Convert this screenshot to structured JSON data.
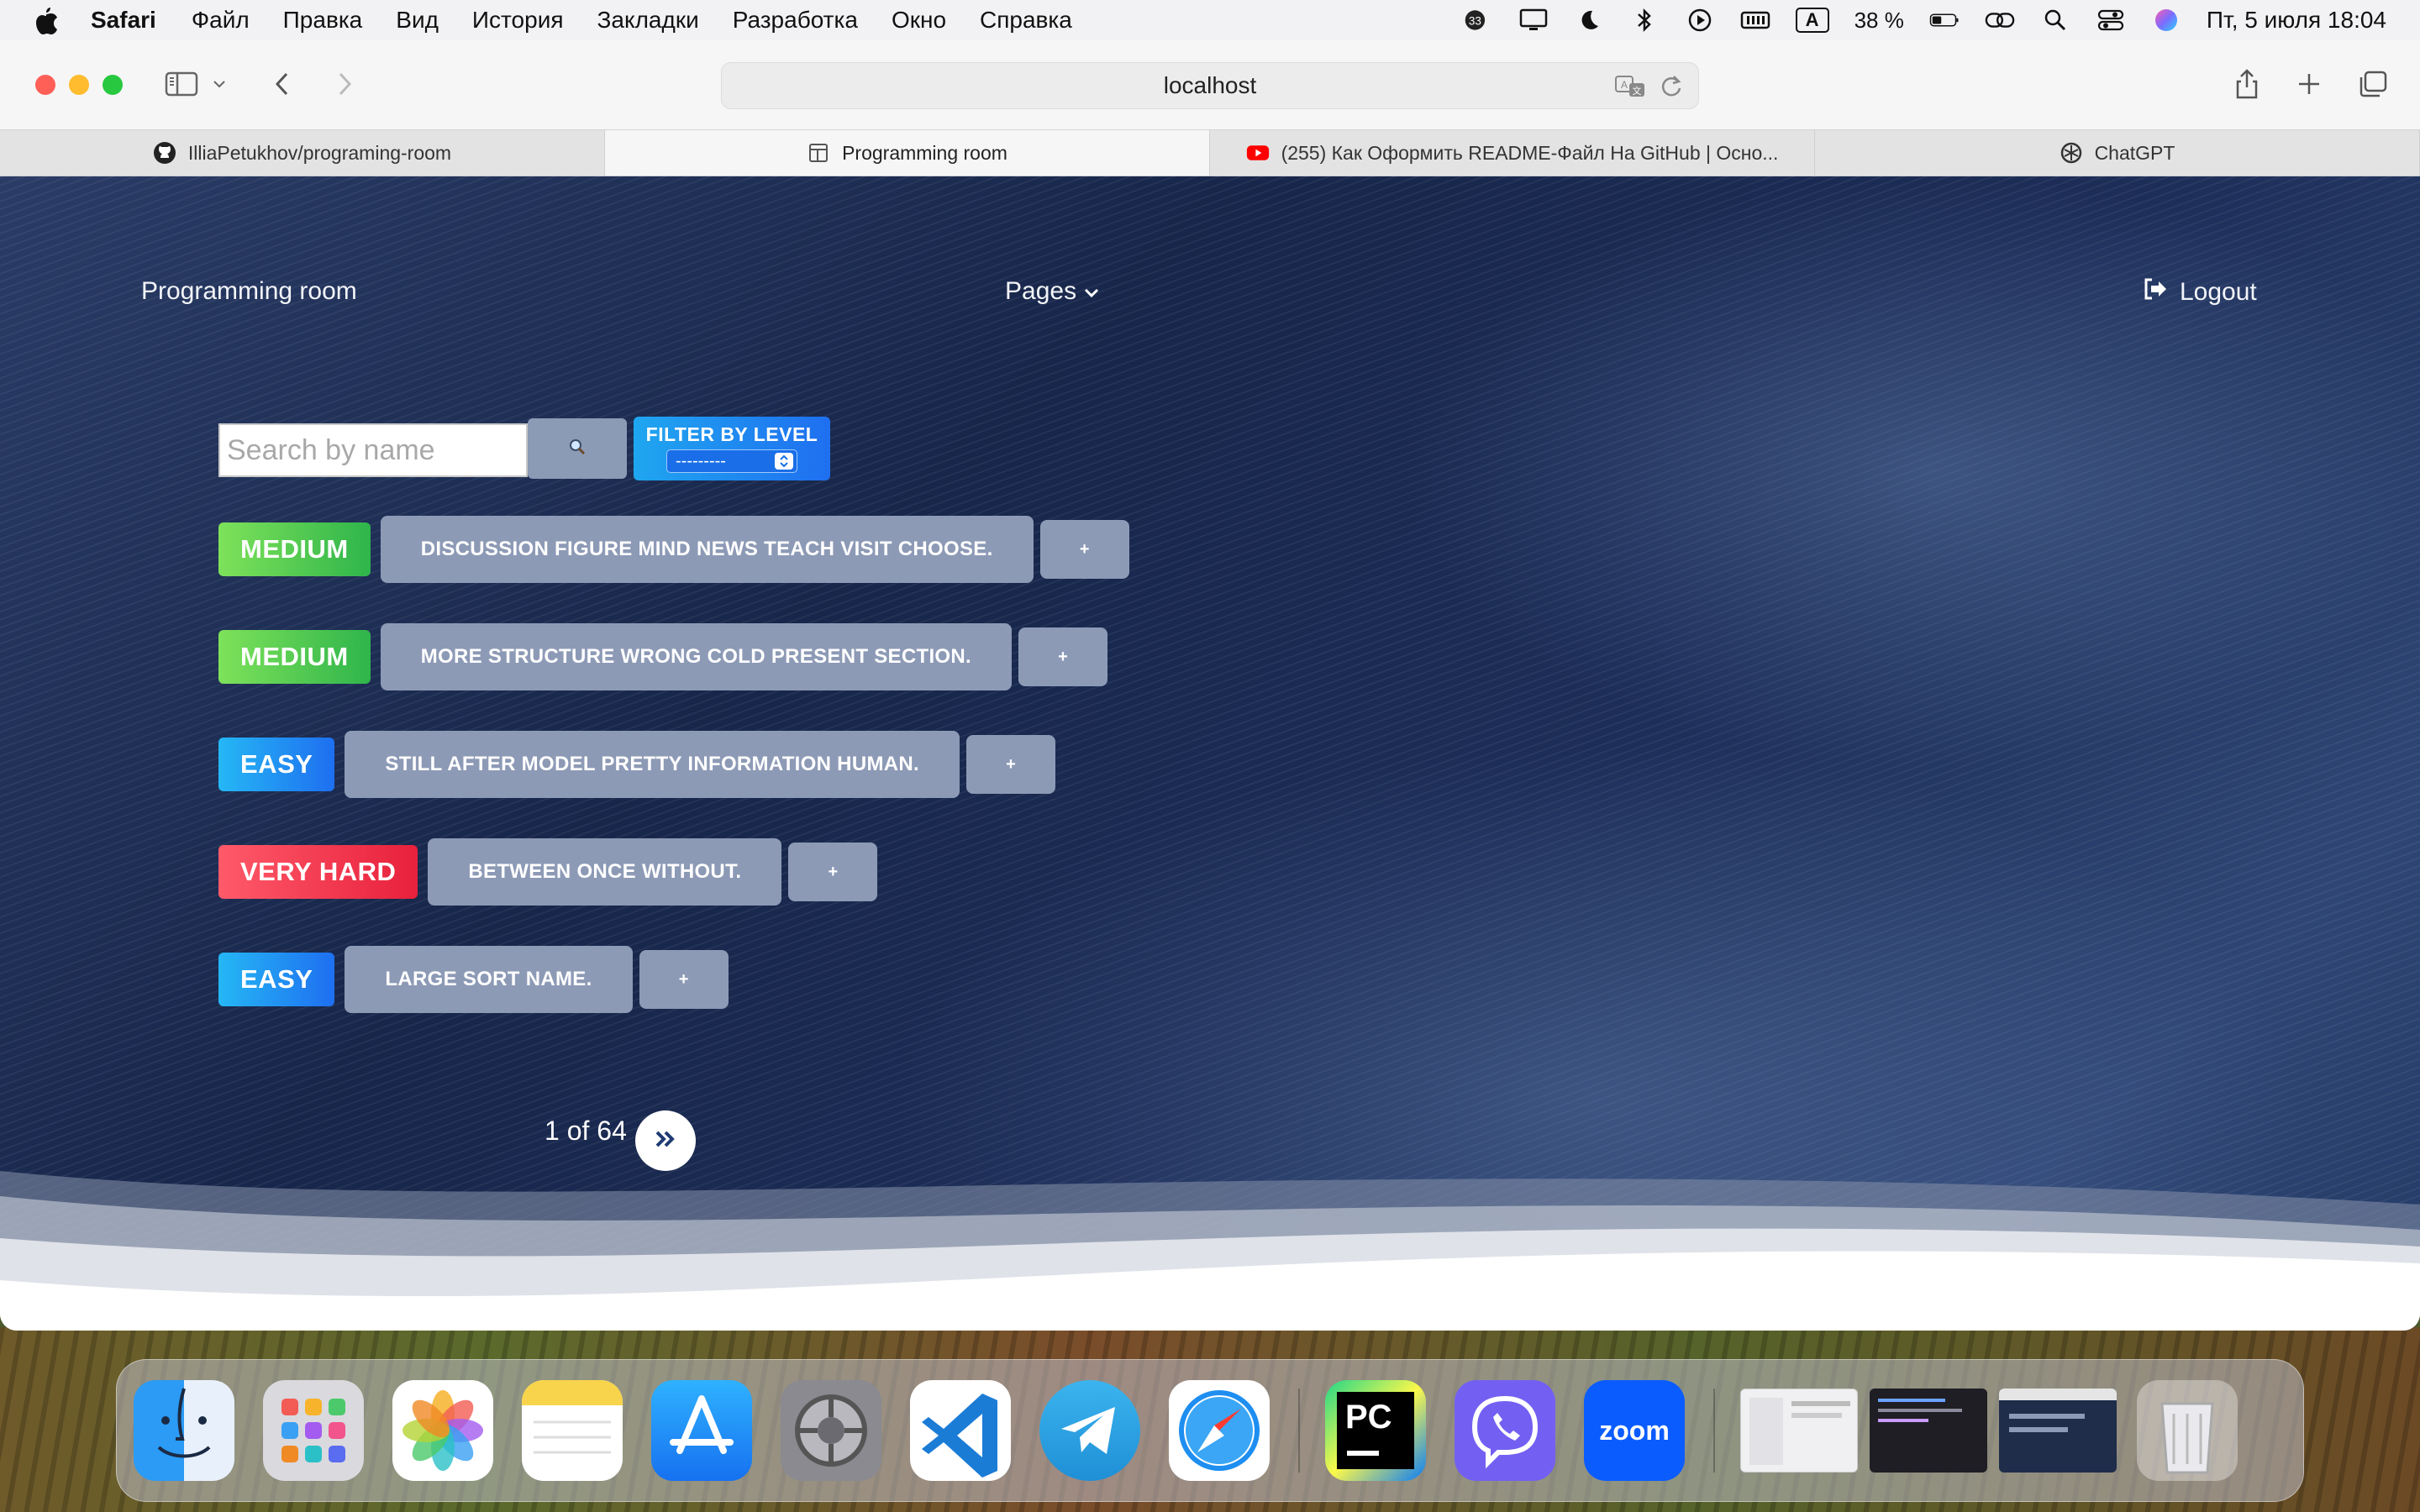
{
  "menubar": {
    "app_name": "Safari",
    "menus": [
      "Файл",
      "Правка",
      "Вид",
      "История",
      "Закладки",
      "Разработка",
      "Окно",
      "Справка"
    ],
    "notification_count": "33",
    "keyboard_layout": "A",
    "battery": "38 %",
    "datetime": "Пт, 5 июля  18:04"
  },
  "browser": {
    "url": "localhost",
    "tabs": [
      {
        "title": "IlliaPetukhov/programing-room",
        "icon": "github-icon"
      },
      {
        "title": "Programming room",
        "icon": "page-icon",
        "active": true
      },
      {
        "title": "(255) Как Оформить README-Файл На GitHub | Осно...",
        "icon": "youtube-icon"
      },
      {
        "title": "ChatGPT",
        "icon": "chatgpt-icon"
      }
    ]
  },
  "page": {
    "nav": {
      "brand": "Programming room",
      "pages_label": "Pages",
      "logout_label": "Logout"
    },
    "search": {
      "placeholder": "Search by name",
      "button_icon": "🔍"
    },
    "filter": {
      "label": "FILTER BY LEVEL",
      "selected": "---------"
    },
    "tasks": [
      {
        "level": "MEDIUM",
        "title": "DISCUSSION FIGURE MIND NEWS TEACH VISIT CHOOSE.",
        "add": "+"
      },
      {
        "level": "MEDIUM",
        "title": "MORE STRUCTURE WRONG COLD PRESENT SECTION.",
        "add": "+"
      },
      {
        "level": "EASY",
        "title": "STILL AFTER MODEL PRETTY INFORMATION HUMAN.",
        "add": "+"
      },
      {
        "level": "VERY HARD",
        "title": "BETWEEN ONCE WITHOUT.",
        "add": "+"
      },
      {
        "level": "EASY",
        "title": "LARGE SORT NAME.",
        "add": "+"
      }
    ],
    "pagination": {
      "text": "1 of 64",
      "next_icon": "double-chevron-right-icon"
    }
  },
  "colors": {
    "medium": "#2fb54b",
    "easy": "#1e6ff0",
    "very_hard": "#e8203b",
    "task_button": "#8d9ab6"
  },
  "dock": {
    "apps": [
      "finder-icon",
      "launchpad-icon",
      "photos-icon",
      "notes-icon",
      "app-store-icon",
      "system-settings-icon",
      "vscode-icon",
      "telegram-icon",
      "safari-icon",
      "pycharm-icon",
      "viber-icon",
      "zoom-icon"
    ],
    "pycharm_label": "PC",
    "zoom_label": "zoom"
  }
}
